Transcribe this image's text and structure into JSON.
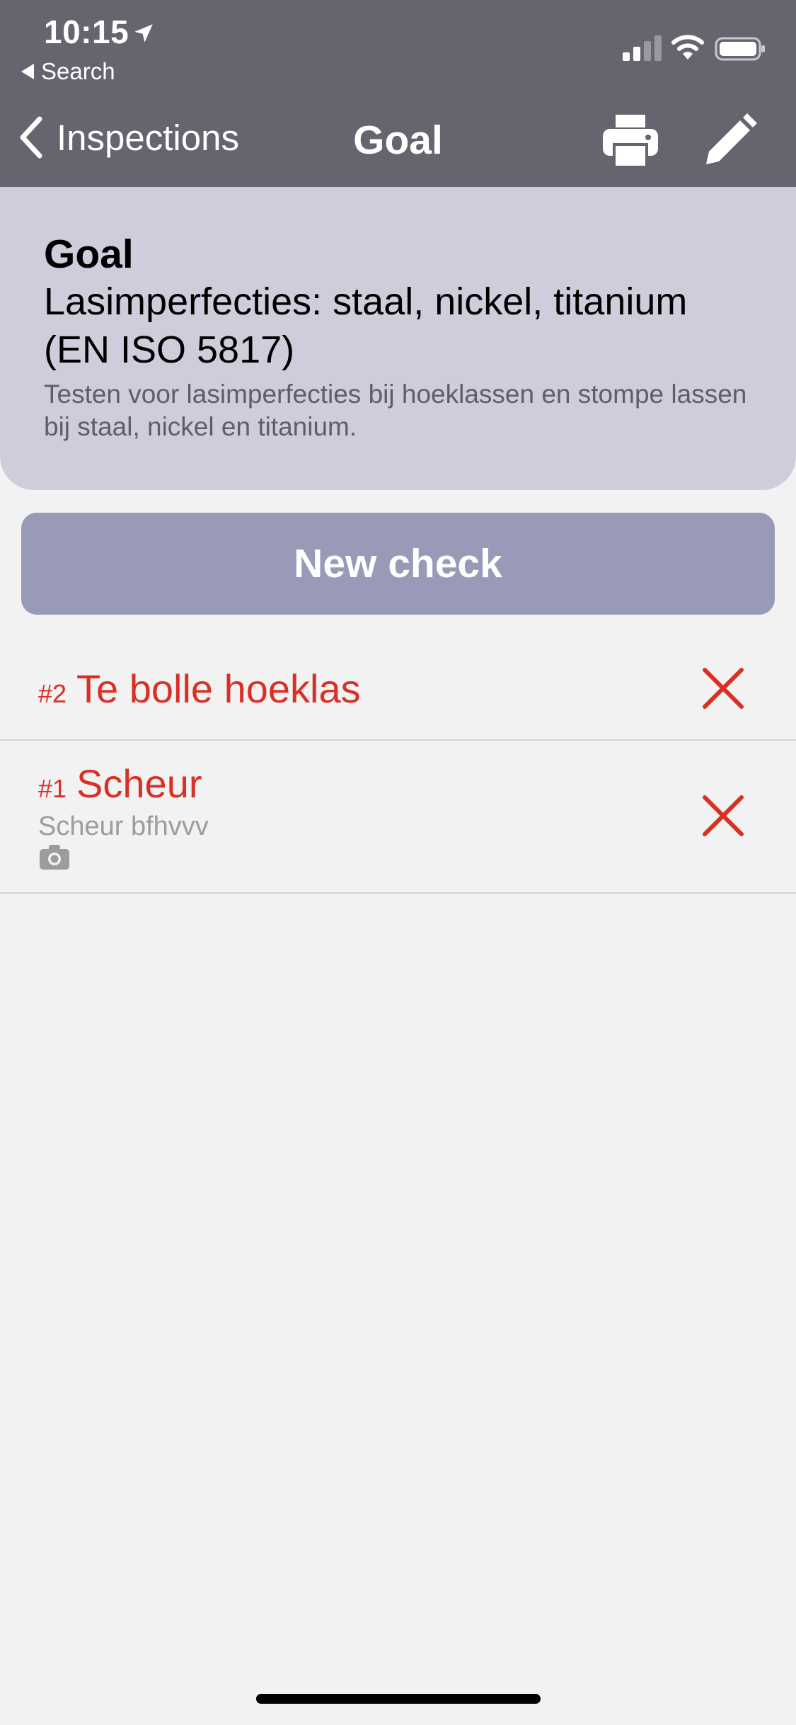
{
  "status_bar": {
    "time": "10:15",
    "back_app": "Search"
  },
  "nav": {
    "back_label": "Inspections",
    "title": "Goal"
  },
  "goal": {
    "label": "Goal",
    "title": "Lasimperfecties: staal, nickel, titanium (EN ISO 5817)",
    "description": "Testen voor lasimperfecties bij hoeklassen en stompe lassen bij staal, nickel en titanium."
  },
  "new_check_label": "New check",
  "checks": [
    {
      "number": "#2",
      "title": "Te bolle hoeklas",
      "subtitle": "",
      "has_photo": false
    },
    {
      "number": "#1",
      "title": "Scheur",
      "subtitle": "Scheur bfhvvv",
      "has_photo": true
    }
  ],
  "colors": {
    "header": "#65646f",
    "card": "#cfcddb",
    "button": "#999ab7",
    "fail": "#d93025",
    "background": "#f2f2f2"
  },
  "icons": [
    "location-arrow-icon",
    "signal-icon",
    "wifi-icon",
    "battery-icon",
    "chevron-left-icon",
    "printer-icon",
    "pencil-icon",
    "close-icon",
    "camera-icon"
  ]
}
